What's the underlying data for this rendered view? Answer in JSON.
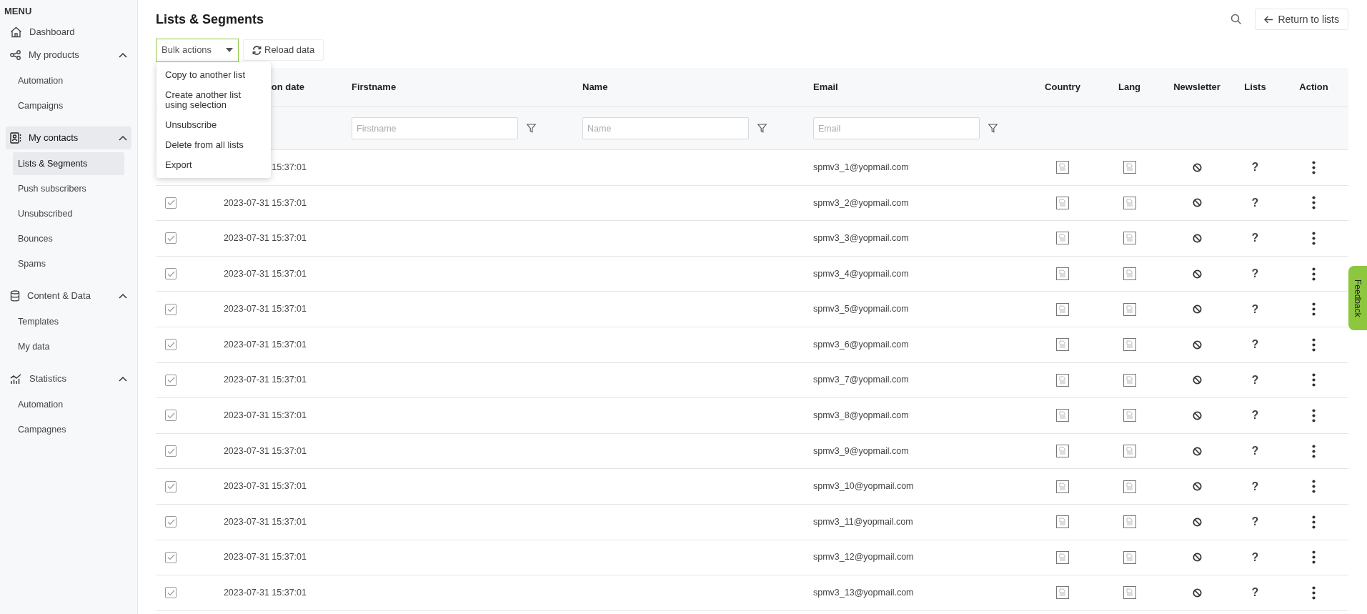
{
  "sidebar": {
    "heading": "MENU",
    "groups": [
      {
        "label": "Dashboard",
        "selected": false
      },
      {
        "label": "My products",
        "selected": false,
        "expanded": true,
        "children": [
          {
            "label": "Automation",
            "selected": false
          },
          {
            "label": "Campaigns",
            "selected": false
          }
        ]
      },
      {
        "label": "My contacts",
        "selected": true,
        "expanded": true,
        "children": [
          {
            "label": "Lists & Segments",
            "selected": true
          },
          {
            "label": "Push subscribers",
            "selected": false
          },
          {
            "label": "Unsubscribed",
            "selected": false
          },
          {
            "label": "Bounces",
            "selected": false
          },
          {
            "label": "Spams",
            "selected": false
          }
        ]
      },
      {
        "label": "Content & Data",
        "selected": false,
        "expanded": true,
        "children": [
          {
            "label": "Templates",
            "selected": false
          },
          {
            "label": "My data",
            "selected": false
          }
        ]
      },
      {
        "label": "Statistics",
        "selected": false,
        "expanded": true,
        "children": [
          {
            "label": "Automation",
            "selected": false
          },
          {
            "label": "Campagnes",
            "selected": false
          }
        ]
      }
    ]
  },
  "page": {
    "title": "Lists & Segments",
    "return_button": "Return to lists"
  },
  "toolbar": {
    "bulk_actions": "Bulk actions",
    "reload_button": "Reload data"
  },
  "bulk_menu": {
    "items": [
      "Copy to another list",
      "Create another list using selection",
      "Unsubscribe",
      "Delete from all lists",
      "Export"
    ]
  },
  "table": {
    "columns": [
      "on date",
      "Firstname",
      "Name",
      "Email",
      "Country",
      "Lang",
      "Newsletter",
      "Lists",
      "Action"
    ],
    "filters": [
      {
        "placeholder": "Firstname"
      },
      {
        "placeholder": "Name"
      },
      {
        "placeholder": "Email"
      }
    ],
    "rows": [
      {
        "date": "15:37:01",
        "email": "spmv3_1@yopmail.com",
        "lists": "?"
      },
      {
        "checked": true,
        "date": "2023-07-31 15:37:01",
        "email": "spmv3_2@yopmail.com",
        "lists": "?"
      },
      {
        "checked": true,
        "date": "2023-07-31 15:37:01",
        "email": "spmv3_3@yopmail.com",
        "lists": "?"
      },
      {
        "checked": true,
        "date": "2023-07-31 15:37:01",
        "email": "spmv3_4@yopmail.com",
        "lists": "?"
      },
      {
        "checked": true,
        "date": "2023-07-31 15:37:01",
        "email": "spmv3_5@yopmail.com",
        "lists": "?"
      },
      {
        "checked": true,
        "date": "2023-07-31 15:37:01",
        "email": "spmv3_6@yopmail.com",
        "lists": "?"
      },
      {
        "checked": true,
        "date": "2023-07-31 15:37:01",
        "email": "spmv3_7@yopmail.com",
        "lists": "?"
      },
      {
        "checked": true,
        "date": "2023-07-31 15:37:01",
        "email": "spmv3_8@yopmail.com",
        "lists": "?"
      },
      {
        "checked": true,
        "date": "2023-07-31 15:37:01",
        "email": "spmv3_9@yopmail.com",
        "lists": "?"
      },
      {
        "checked": true,
        "date": "2023-07-31 15:37:01",
        "email": "spmv3_10@yopmail.com",
        "lists": "?"
      },
      {
        "checked": true,
        "date": "2023-07-31 15:37:01",
        "email": "spmv3_11@yopmail.com",
        "lists": "?"
      },
      {
        "checked": true,
        "date": "2023-07-31 15:37:01",
        "email": "spmv3_12@yopmail.com",
        "lists": "?"
      },
      {
        "checked": true,
        "date": "2023-07-31 15:37:01",
        "email": "spmv3_13@yopmail.com",
        "lists": "?"
      }
    ]
  },
  "feedback_tab": "Feedback"
}
